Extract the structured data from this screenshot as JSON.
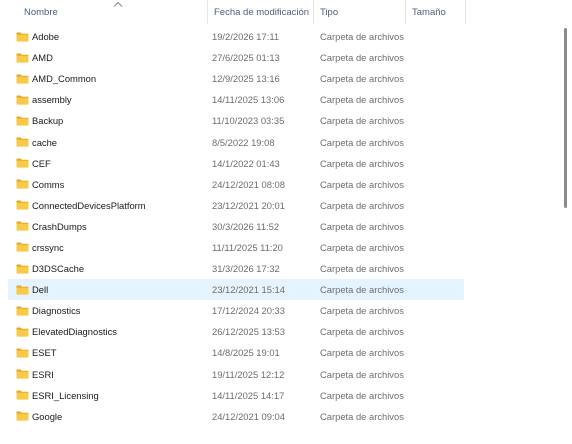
{
  "columns": {
    "name": "Nombre",
    "date": "Fecha de modificación",
    "type": "Tipo",
    "size": "Tamaño"
  },
  "sort": {
    "column": "name",
    "icon": "chevron-up-icon"
  },
  "rows": [
    {
      "name": "Adobe",
      "date": "19/2/2026 17:11",
      "type": "Carpeta de archivos",
      "size": ""
    },
    {
      "name": "AMD",
      "date": "27/6/2025 01:13",
      "type": "Carpeta de archivos",
      "size": ""
    },
    {
      "name": "AMD_Common",
      "date": "12/9/2025 13:16",
      "type": "Carpeta de archivos",
      "size": ""
    },
    {
      "name": "assembly",
      "date": "14/11/2025 13:06",
      "type": "Carpeta de archivos",
      "size": ""
    },
    {
      "name": "Backup",
      "date": "11/10/2023 03:35",
      "type": "Carpeta de archivos",
      "size": ""
    },
    {
      "name": "cache",
      "date": "8/5/2022 19:08",
      "type": "Carpeta de archivos",
      "size": ""
    },
    {
      "name": "CEF",
      "date": "14/1/2022 01:43",
      "type": "Carpeta de archivos",
      "size": ""
    },
    {
      "name": "Comms",
      "date": "24/12/2021 08:08",
      "type": "Carpeta de archivos",
      "size": ""
    },
    {
      "name": "ConnectedDevicesPlatform",
      "date": "23/12/2021 20:01",
      "type": "Carpeta de archivos",
      "size": ""
    },
    {
      "name": "CrashDumps",
      "date": "30/3/2026 11:52",
      "type": "Carpeta de archivos",
      "size": ""
    },
    {
      "name": "crssync",
      "date": "11/11/2025 11:20",
      "type": "Carpeta de archivos",
      "size": ""
    },
    {
      "name": "D3DSCache",
      "date": "31/3/2026 17:32",
      "type": "Carpeta de archivos",
      "size": ""
    },
    {
      "name": "Dell",
      "date": "23/12/2021 15:14",
      "type": "Carpeta de archivos",
      "size": "",
      "selected": true
    },
    {
      "name": "Diagnostics",
      "date": "17/12/2024 20:33",
      "type": "Carpeta de archivos",
      "size": ""
    },
    {
      "name": "ElevatedDiagnostics",
      "date": "26/12/2025 13:53",
      "type": "Carpeta de archivos",
      "size": ""
    },
    {
      "name": "ESET",
      "date": "14/8/2025 19:01",
      "type": "Carpeta de archivos",
      "size": ""
    },
    {
      "name": "ESRI",
      "date": "19/11/2025 12:12",
      "type": "Carpeta de archivos",
      "size": ""
    },
    {
      "name": "ESRI_Licensing",
      "date": "14/11/2025 14:17",
      "type": "Carpeta de archivos",
      "size": ""
    },
    {
      "name": "Google",
      "date": "24/12/2021 09:04",
      "type": "Carpeta de archivos",
      "size": ""
    }
  ],
  "icons": {
    "folder": "folder-icon"
  },
  "colors": {
    "selection": "#e5f3ff",
    "folder": "#f8c94a",
    "folder_tab": "#e6a817",
    "header_text": "#4c607a"
  }
}
